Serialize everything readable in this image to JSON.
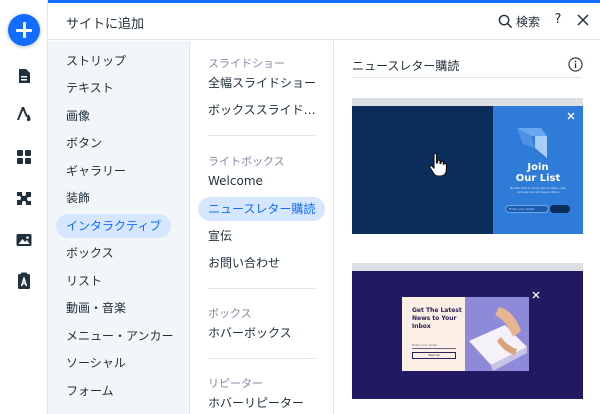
{
  "header": {
    "title": "サイトに追加",
    "search_label": "検索",
    "help_label": "?"
  },
  "rail": {
    "items": [
      {
        "icon": "plus-icon"
      },
      {
        "icon": "page-icon"
      },
      {
        "icon": "design-icon"
      },
      {
        "icon": "apps-grid-icon"
      },
      {
        "icon": "puzzle-icon"
      },
      {
        "icon": "media-icon"
      },
      {
        "icon": "portfolio-icon"
      }
    ]
  },
  "categories": [
    {
      "label": "ストリップ",
      "active": false
    },
    {
      "label": "テキスト",
      "active": false
    },
    {
      "label": "画像",
      "active": false
    },
    {
      "label": "ボタン",
      "active": false
    },
    {
      "label": "ギャラリー",
      "active": false
    },
    {
      "label": "装飾",
      "active": false
    },
    {
      "label": "インタラクティブ",
      "active": true
    },
    {
      "label": "ボックス",
      "active": false
    },
    {
      "label": "リスト",
      "active": false
    },
    {
      "label": "動画・音楽",
      "active": false
    },
    {
      "label": "メニュー・アンカー",
      "active": false
    },
    {
      "label": "ソーシャル",
      "active": false
    },
    {
      "label": "フォーム",
      "active": false
    }
  ],
  "subcategories": {
    "slideshow_heading": "スライドショー",
    "slideshow_items": [
      "全幅スライドショー",
      "ボックススライドショー"
    ],
    "lightbox_heading": "ライトボックス",
    "lightbox_items": [
      "Welcome",
      "ニュースレター購読",
      "宣伝",
      "お問い合わせ"
    ],
    "box_heading": "ボックス",
    "box_items": [
      "ホバーボックス"
    ],
    "repeater_heading": "リピーター",
    "repeater_items": [
      "ホバーリピーター"
    ]
  },
  "preview": {
    "title": "ニュースレター購読",
    "thumb1": {
      "heading_line1": "Join",
      "heading_line2": "Our List",
      "body": "Be the first to know about sales, new arrivals and exclusive offers",
      "input_placeholder": "Enter your email"
    },
    "thumb2": {
      "heading": "Get The Latest News to Your Inbox",
      "input_label": "Enter your email",
      "button_label": "Sign Up"
    }
  },
  "colors": {
    "accent": "#116dff",
    "selected_bg": "#d6e6fe",
    "category_bg": "#f3f6f8",
    "thumb1_dark": "#0b2d5a",
    "thumb1_blue": "#2f7bd8",
    "thumb2_bg": "#211a63",
    "thumb2_card": "#fbeee4"
  }
}
